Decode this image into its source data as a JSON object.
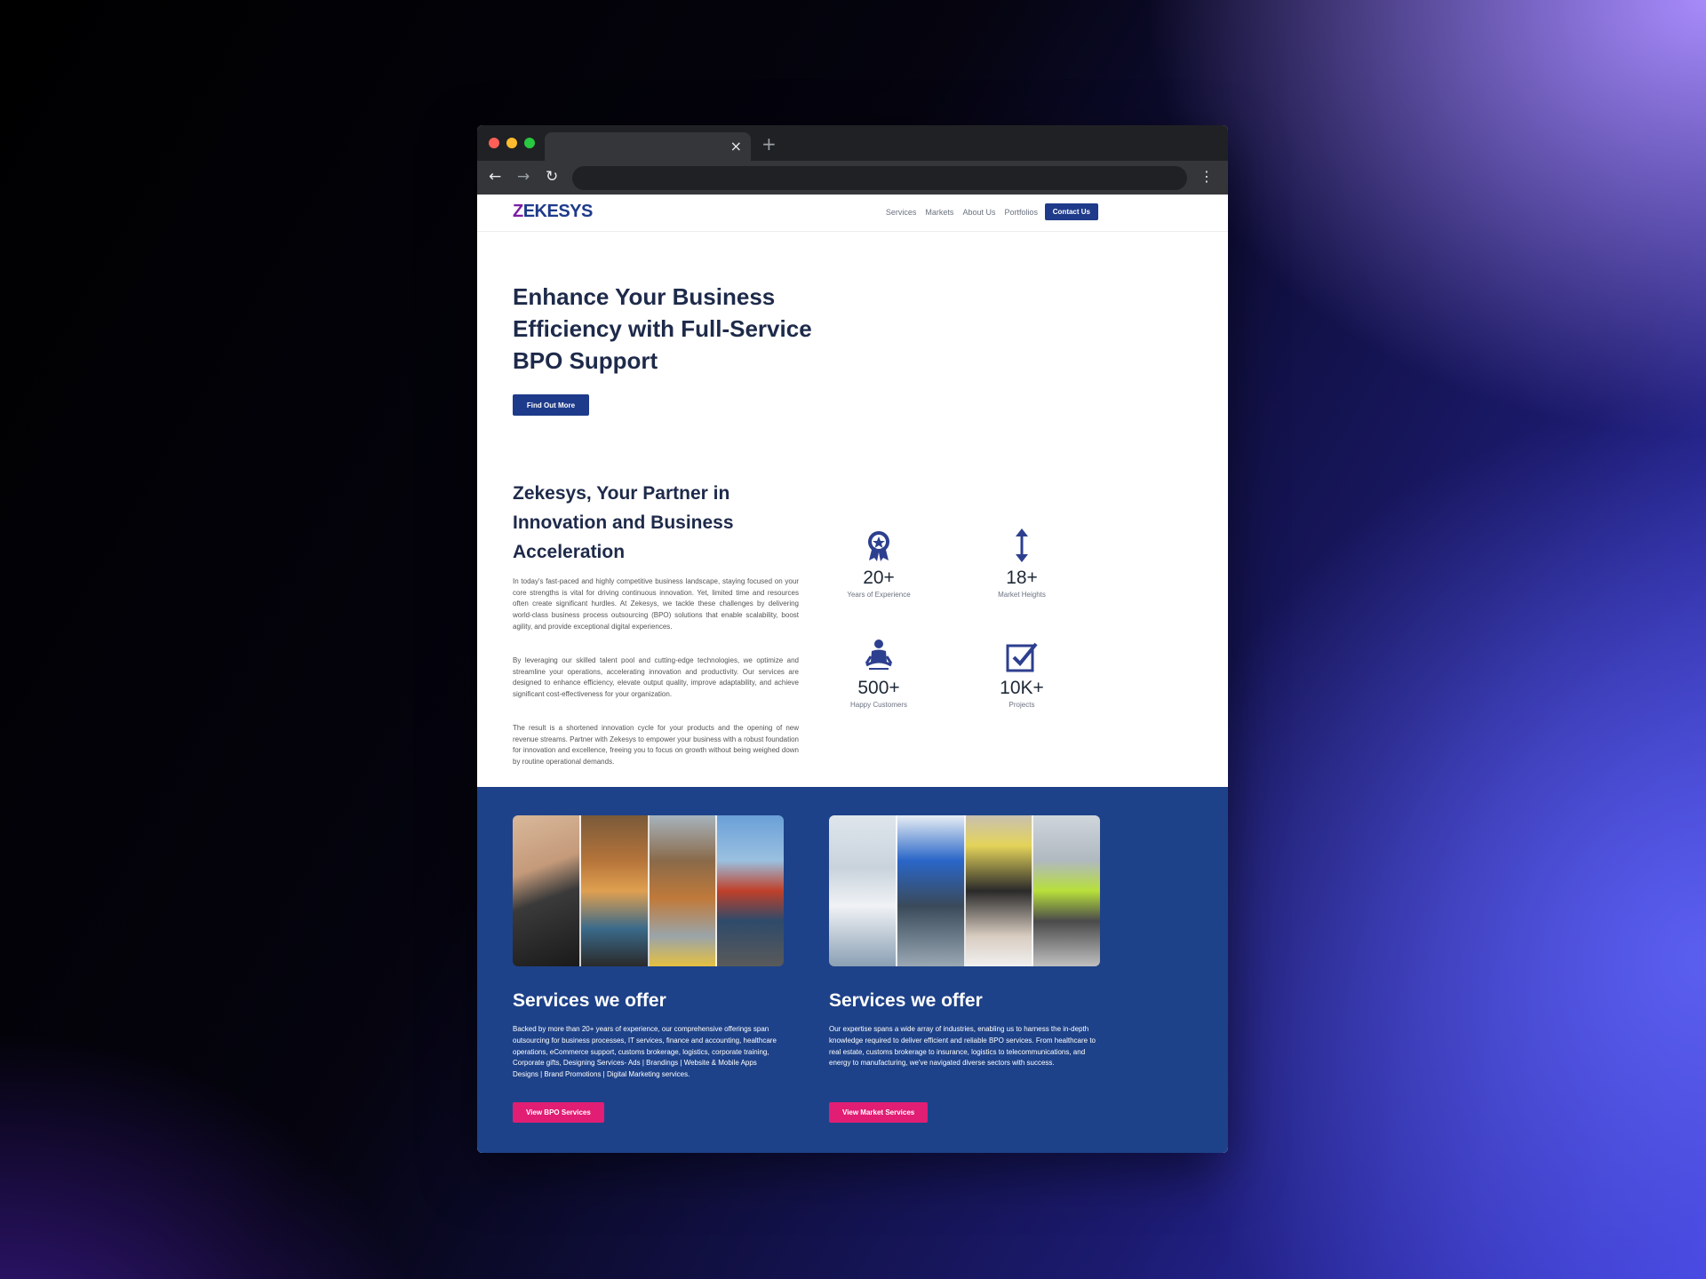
{
  "browser": {
    "tab_close": "×",
    "new_tab": "+",
    "back": "←",
    "forward": "→",
    "reload": "↻",
    "menu": "⋮",
    "dot_colors": [
      "#ff5f57",
      "#febc2e",
      "#28c840"
    ]
  },
  "nav": {
    "logo_prefix": "Z",
    "logo_rest": "EKESYS",
    "items": [
      "Services",
      "Markets",
      "About Us",
      "Portfolios"
    ],
    "contact": "Contact Us"
  },
  "hero": {
    "title": "Enhance Your Business Efficiency with Full-Service BPO Support",
    "button": "Find Out More"
  },
  "about": {
    "title": "Zekesys, Your Partner in Innovation and Business Acceleration",
    "paragraphs": [
      "In today's fast-paced and highly competitive business landscape, staying focused on your core strengths is vital for driving continuous innovation. Yet, limited time and resources often create significant hurdles. At Zekesys, we tackle these challenges by delivering world-class business process outsourcing (BPO) solutions that enable scalability, boost agility, and provide exceptional digital experiences.",
      "By leveraging our skilled talent pool and cutting-edge technologies, we optimize and streamline your operations, accelerating innovation and productivity. Our services are designed to enhance efficiency, elevate output quality, improve adaptability, and achieve significant cost-effectiveness for your organization.",
      "The result is a shortened innovation cycle for your products and the opening of new revenue streams. Partner with Zekesys to empower your business with a robust foundation for innovation and excellence, freeing you to focus on growth without being weighed down by routine operational demands."
    ]
  },
  "stats": [
    {
      "icon": "award-badge-icon",
      "value": "20+",
      "label": "Years of Experience"
    },
    {
      "icon": "vertical-arrows-icon",
      "value": "18+",
      "label": "Market Heights"
    },
    {
      "icon": "person-meditation-icon",
      "value": "500+",
      "label": "Happy Customers"
    },
    {
      "icon": "checkbox-icon",
      "value": "10K+",
      "label": "Projects"
    }
  ],
  "cards": [
    {
      "title": "Services we offer",
      "text": "Backed by more than 20+ years of experience, our comprehensive offerings span outsourcing for business processes, IT services, finance and accounting, healthcare operations, eCommerce support, customs brokerage, logistics, corporate training, Corporate gifts, Designing Services- Ads | Brandings | Website & Mobile Apps Designs | Brand Promotions | Digital Marketing services.",
      "button": "View BPO Services",
      "image": "bpo-collage"
    },
    {
      "title": "Services we offer",
      "text": "Our expertise spans a wide array of industries, enabling us to harness the in-depth knowledge required to deliver efficient and reliable BPO services. From healthcare to real estate, customs brokerage to insurance, logistics to telecommunications, and energy to manufacturing, we've navigated diverse sectors with success.",
      "button": "View Market Services",
      "image": "markets-collage"
    }
  ],
  "colors": {
    "primary": "#1e3a8a",
    "section_blue": "#1e4289",
    "accent_pink": "#e11d74",
    "heading": "#1e2a4a"
  }
}
